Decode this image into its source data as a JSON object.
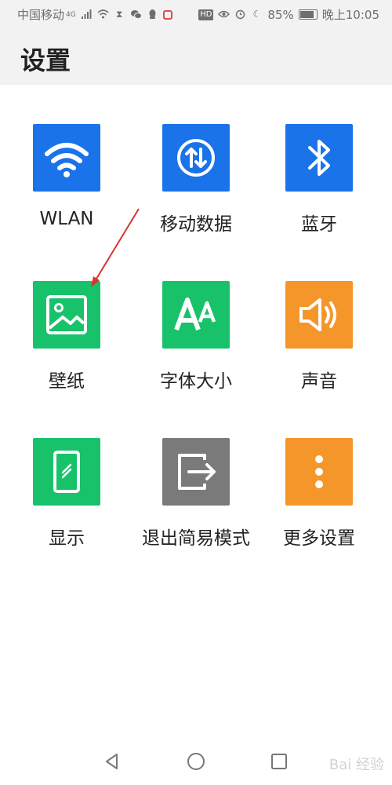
{
  "status_bar": {
    "carrier": "中国移动",
    "network": "4G",
    "battery": "85%",
    "battery_level": 0.85,
    "time": "晚上10:05",
    "hd_label": "HD"
  },
  "header": {
    "title": "设置"
  },
  "tiles": [
    {
      "label": "WLAN",
      "icon": "wifi-icon",
      "color": "#1a73e8"
    },
    {
      "label": "移动数据",
      "icon": "mobile-data-icon",
      "color": "#1a73e8"
    },
    {
      "label": "蓝牙",
      "icon": "bluetooth-icon",
      "color": "#1a73e8"
    },
    {
      "label": "壁纸",
      "icon": "wallpaper-icon",
      "color": "#17c26b"
    },
    {
      "label": "字体大小",
      "icon": "font-size-icon",
      "color": "#17c26b"
    },
    {
      "label": "声音",
      "icon": "sound-icon",
      "color": "#f5962a"
    },
    {
      "label": "显示",
      "icon": "display-icon",
      "color": "#17c26b"
    },
    {
      "label": "退出简易模式",
      "icon": "exit-icon",
      "color": "#7a7a7a"
    },
    {
      "label": "更多设置",
      "icon": "more-icon",
      "color": "#f5962a"
    }
  ],
  "nav_bar": {
    "watermark": "Bai 经验"
  }
}
